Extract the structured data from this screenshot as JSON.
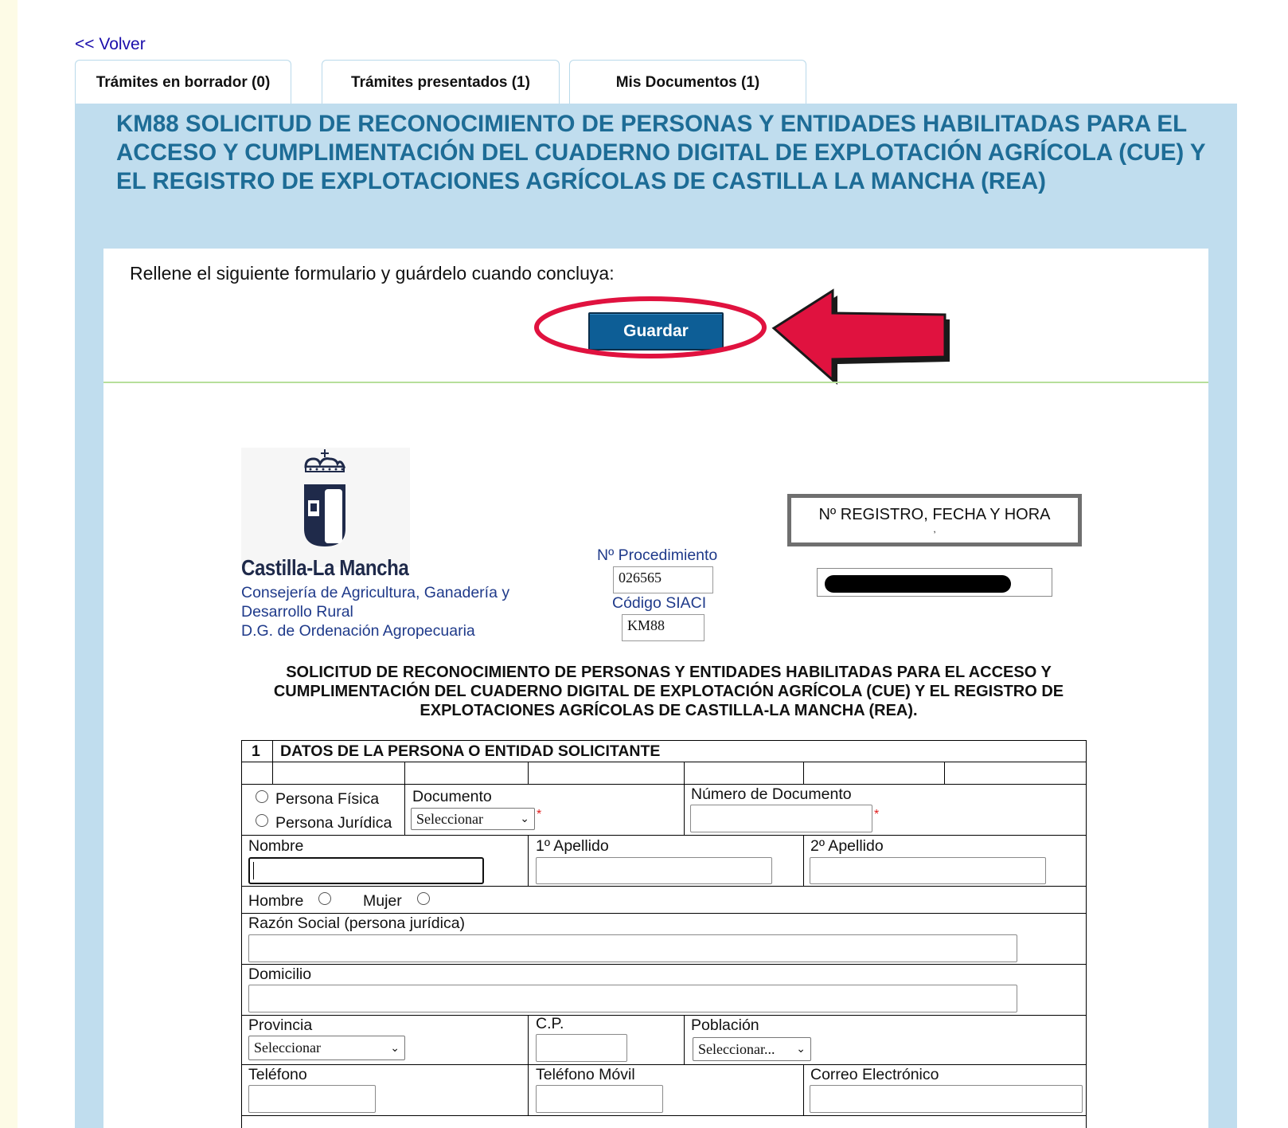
{
  "nav": {
    "back": "<< Volver"
  },
  "tabs": [
    {
      "label": "Trámites en borrador (0)"
    },
    {
      "label": "Trámites presentados (1)"
    },
    {
      "label": "Mis Documentos (1)"
    }
  ],
  "procedure_title": "KM88 SOLICITUD DE RECONOCIMIENTO DE PERSONAS Y ENTIDADES HABILITADAS PARA EL ACCESO Y CUMPLIMENTACIÓN DEL CUADERNO DIGITAL DE EXPLOTACIÓN AGRÍCOLA (CUE) Y EL REGISTRO DE EXPLOTACIONES AGRÍCOLAS DE CASTILLA LA MANCHA (REA)",
  "instructions": "Rellene el siguiente formulario y guárdelo cuando concluya:",
  "save_button": "Guardar",
  "header": {
    "brand": "Castilla-La Mancha",
    "dept_line1": "Consejería de Agricultura, Ganadería y",
    "dept_line2": "Desarrollo Rural",
    "dept_line3": "D.G. de Ordenación Agropecuaria",
    "registro_label": "Nº REGISTRO, FECHA Y HORA",
    "registro_value": ",",
    "procedimiento_label": "Nº Procedimiento",
    "procedimiento_value": "026565",
    "siaci_label": "Código SIACI",
    "siaci_value": "KM88"
  },
  "form_title": "SOLICITUD DE RECONOCIMIENTO DE PERSONAS Y ENTIDADES HABILITADAS PARA EL ACCESO Y CUMPLIMENTACIÓN DEL CUADERNO DIGITAL DE EXPLOTACIÓN AGRÍCOLA (CUE) Y EL REGISTRO DE EXPLOTACIONES AGRÍCOLAS DE CASTILLA-LA MANCHA (REA).",
  "section1": {
    "number": "1",
    "title": "DATOS DE LA PERSONA O ENTIDAD SOLICITANTE",
    "persona_fisica": "Persona Física",
    "persona_juridica": "Persona Jurídica",
    "documento_label": "Documento",
    "documento_value": "Seleccionar",
    "numero_documento_label": "Número de Documento",
    "nombre_label": "Nombre",
    "apellido1_label": "1º Apellido",
    "apellido2_label": "2º Apellido",
    "hombre": "Hombre",
    "mujer": "Mujer",
    "razon_social_label": "Razón Social (persona jurídica)",
    "domicilio_label": "Domicilio",
    "provincia_label": "Provincia",
    "provincia_value": "Seleccionar",
    "cp_label": "C.P.",
    "poblacion_label": "Población",
    "poblacion_value": "Seleccionar...",
    "telefono_label": "Teléfono",
    "movil_label": "Teléfono Móvil",
    "email_label": "Correo Electrónico",
    "required_mark": "*"
  },
  "colors": {
    "title": "#1d6c96",
    "panel": "#c0ddee",
    "button": "#0d5e96",
    "annotation": "#e0123f",
    "link": "#1a0dab"
  }
}
